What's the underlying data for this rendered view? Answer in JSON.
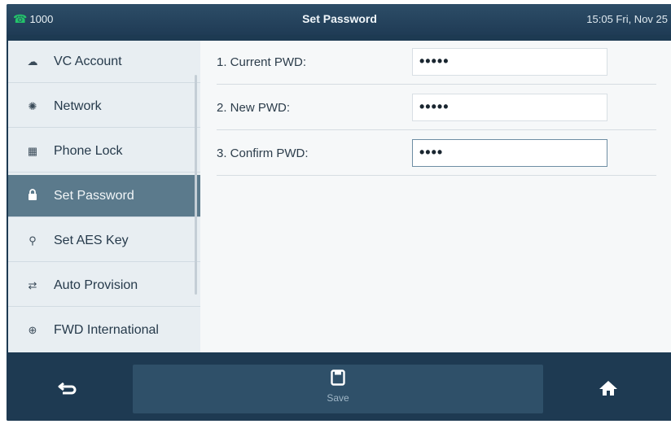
{
  "statusbar": {
    "account": "1000",
    "title": "Set Password",
    "datetime": "15:05 Fri, Nov 25"
  },
  "sidebar": {
    "items": [
      {
        "label": "VC Account",
        "icon": "cloud-icon"
      },
      {
        "label": "Network",
        "icon": "network-icon"
      },
      {
        "label": "Phone Lock",
        "icon": "phone-lock-icon"
      },
      {
        "label": "Set Password",
        "icon": "lock-icon",
        "active": true
      },
      {
        "label": "Set AES Key",
        "icon": "key-icon"
      },
      {
        "label": "Auto Provision",
        "icon": "auto-provision-icon"
      },
      {
        "label": "FWD International",
        "icon": "globe-icon"
      }
    ]
  },
  "form": {
    "rows": [
      {
        "label": "1. Current PWD:",
        "value": "•••••"
      },
      {
        "label": "2. New PWD:",
        "value": "•••••"
      },
      {
        "label": "3. Confirm PWD:",
        "value": "••••"
      }
    ]
  },
  "softkeys": {
    "save_label": "Save"
  },
  "colors": {
    "header": "#1f3b55",
    "active_item": "#5b7a8c",
    "sidebar_bg": "#e8eef2",
    "content_bg": "#f6f8f9",
    "line_status": "#23c36a"
  }
}
